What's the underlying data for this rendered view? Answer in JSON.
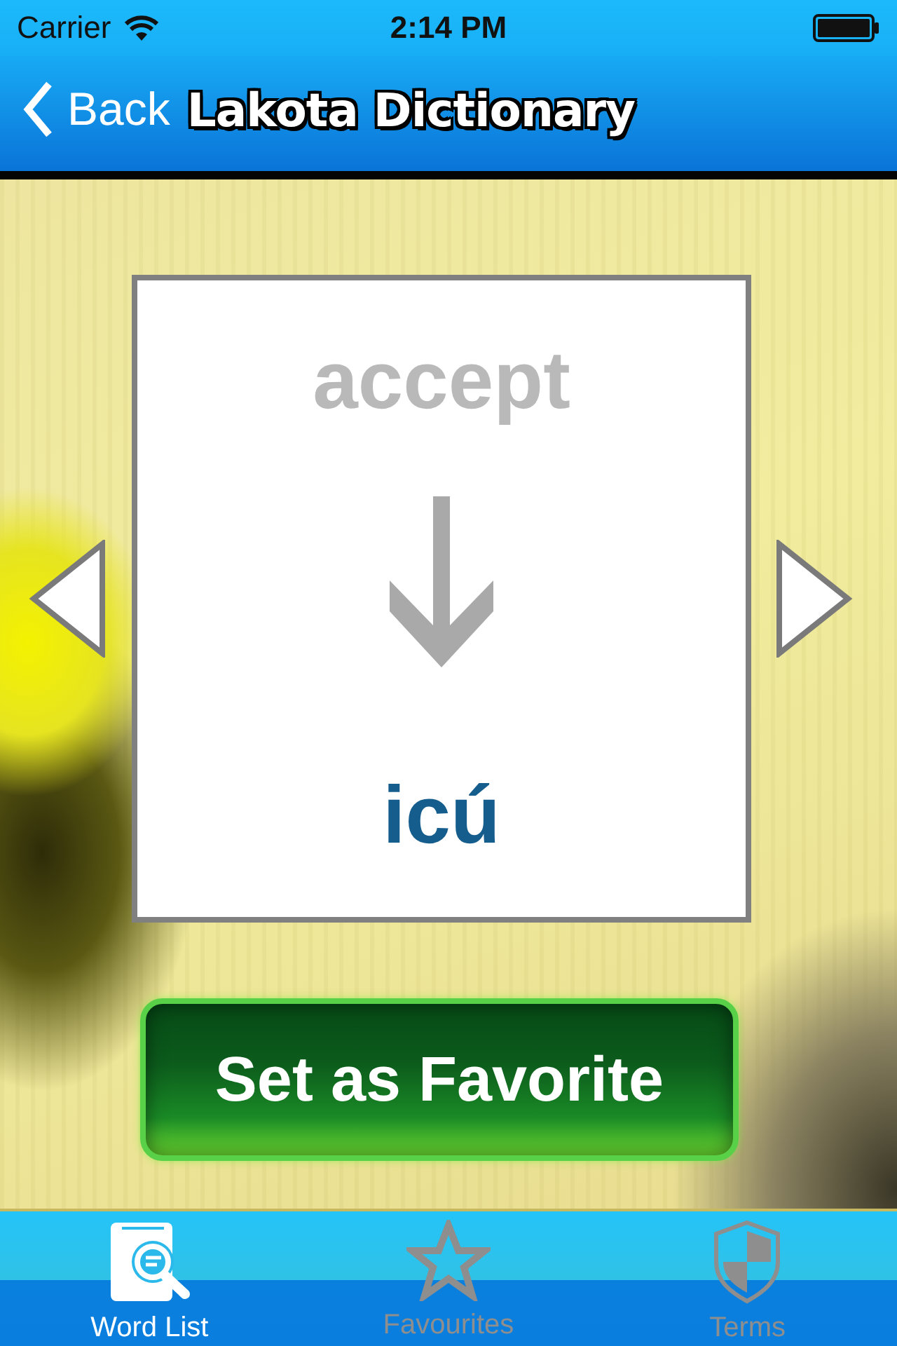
{
  "status_bar": {
    "carrier": "Carrier",
    "time": "2:14 PM"
  },
  "nav_bar": {
    "back_label": "Back",
    "title": "Lakota Dictionary"
  },
  "card": {
    "word": "accept",
    "translation": "icú"
  },
  "favorite_button": {
    "label": "Set as Favorite"
  },
  "tab_bar": {
    "tabs": [
      {
        "kind": "book",
        "label": "Word List",
        "selected": true
      },
      {
        "kind": "star",
        "label": "Favourites",
        "selected": false
      },
      {
        "kind": "shield",
        "label": "Terms",
        "selected": false
      }
    ]
  }
}
